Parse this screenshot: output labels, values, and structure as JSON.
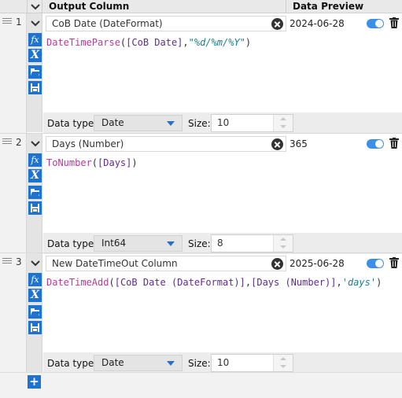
{
  "header": {
    "output_column": "Output Column",
    "data_preview": "Data Preview"
  },
  "rows": [
    {
      "number": "1",
      "name": "CoB Date (DateFormat)",
      "preview": "2024-06-28",
      "expr": {
        "fn": "DateTimeParse",
        "open": "(",
        "col": "[CoB Date]",
        "comma": ",",
        "str": "\"%d/%m/%Y\"",
        "close": ")"
      },
      "data_type_label": "Data type:",
      "data_type": "Date",
      "size_label": "Size:",
      "size": "10"
    },
    {
      "number": "2",
      "name": "Days (Number)",
      "preview": "365",
      "expr": {
        "fn": "ToNumber",
        "open": "(",
        "col": "[Days]",
        "close": ")"
      },
      "data_type_label": "Data type:",
      "data_type": "Int64",
      "size_label": "Size:",
      "size": "8"
    },
    {
      "number": "3",
      "name": "New DateTimeOut Column",
      "preview": "2025-06-28",
      "expr": {
        "fn": "DateTimeAdd",
        "open": "(",
        "col1": "[CoB Date (DateFormat)]",
        "comma1": ",",
        "col2": "[Days (Number)]",
        "comma2": ",",
        "str": "'days'",
        "close": ")"
      },
      "data_type_label": "Data type:",
      "data_type": "Date",
      "size_label": "Size:",
      "size": "10"
    }
  ],
  "icons": {
    "function": "fx",
    "variables": "X",
    "open": "folder-icon",
    "save": "save-icon",
    "add": "+"
  },
  "colors": {
    "accent": "#1f73d0",
    "toggle": "#3b8fe6",
    "function_name": "#b53a9a",
    "column_ref": "#5d2c8e",
    "string_literal": "#1c7d8b"
  }
}
